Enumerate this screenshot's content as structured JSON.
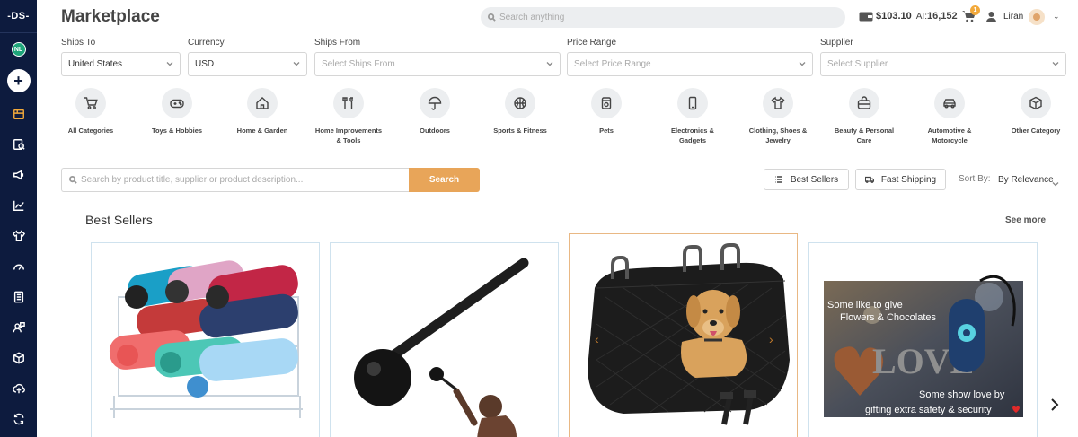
{
  "sidebar": {
    "logo": "-DS-",
    "user_initials": "NL",
    "add_label": "+"
  },
  "header": {
    "title": "Marketplace",
    "search_placeholder": "Search anything",
    "balance": "$103.10",
    "ai_label": "AI:",
    "ai_credits": "16,152",
    "cart_count": "1",
    "username": "Liran"
  },
  "filters": {
    "ships_to": {
      "label": "Ships To",
      "value": "United States"
    },
    "currency": {
      "label": "Currency",
      "value": "USD"
    },
    "ships_from": {
      "label": "Ships From",
      "placeholder": "Select Ships From"
    },
    "price_range": {
      "label": "Price Range",
      "placeholder": "Select Price Range"
    },
    "supplier": {
      "label": "Supplier",
      "placeholder": "Select Supplier"
    }
  },
  "categories": [
    {
      "label": "All Categories",
      "icon": "cart-icon"
    },
    {
      "label": "Toys & Hobbies",
      "icon": "gamepad-icon"
    },
    {
      "label": "Home & Garden",
      "icon": "house-icon"
    },
    {
      "label": "Home Improvements & Tools",
      "icon": "tools-icon"
    },
    {
      "label": "Outdoors",
      "icon": "umbrella-icon"
    },
    {
      "label": "Sports & Fitness",
      "icon": "basketball-icon"
    },
    {
      "label": "Pets",
      "icon": "pet-food-icon"
    },
    {
      "label": "Electronics & Gadgets",
      "icon": "phone-icon"
    },
    {
      "label": "Clothing, Shoes & Jewelry",
      "icon": "shirt-icon"
    },
    {
      "label": "Beauty & Personal Care",
      "icon": "cosmetics-bag-icon"
    },
    {
      "label": "Automotive & Motorcycle",
      "icon": "car-icon"
    },
    {
      "label": "Other Category",
      "icon": "box-icon"
    }
  ],
  "product_search": {
    "placeholder": "Search by product title, supplier or product description...",
    "button": "Search"
  },
  "toolbar": {
    "best_sellers": "Best Sellers",
    "fast_shipping": "Fast Shipping",
    "sort_by_label": "Sort By:",
    "sort_by_value": "By Relevance"
  },
  "best_sellers": {
    "title": "Best Sellers",
    "see_more": "See more",
    "products": [
      {
        "image": "water-bottles-with-rack"
      },
      {
        "image": "steel-mace-fitness"
      },
      {
        "image": "dog-car-seat-cover"
      },
      {
        "image": "personal-safety-alarm-love",
        "image_text_1": "Some like to give",
        "image_text_2": "Flowers & Chocolates",
        "image_text_3": "LOVE",
        "image_text_4": "Some show love by",
        "image_text_5": "gifting extra safety & security"
      }
    ]
  },
  "colors": {
    "sidebar_bg": "#0d1b3e",
    "accent": "#e8a559",
    "highlight_border": "#e9b884"
  }
}
